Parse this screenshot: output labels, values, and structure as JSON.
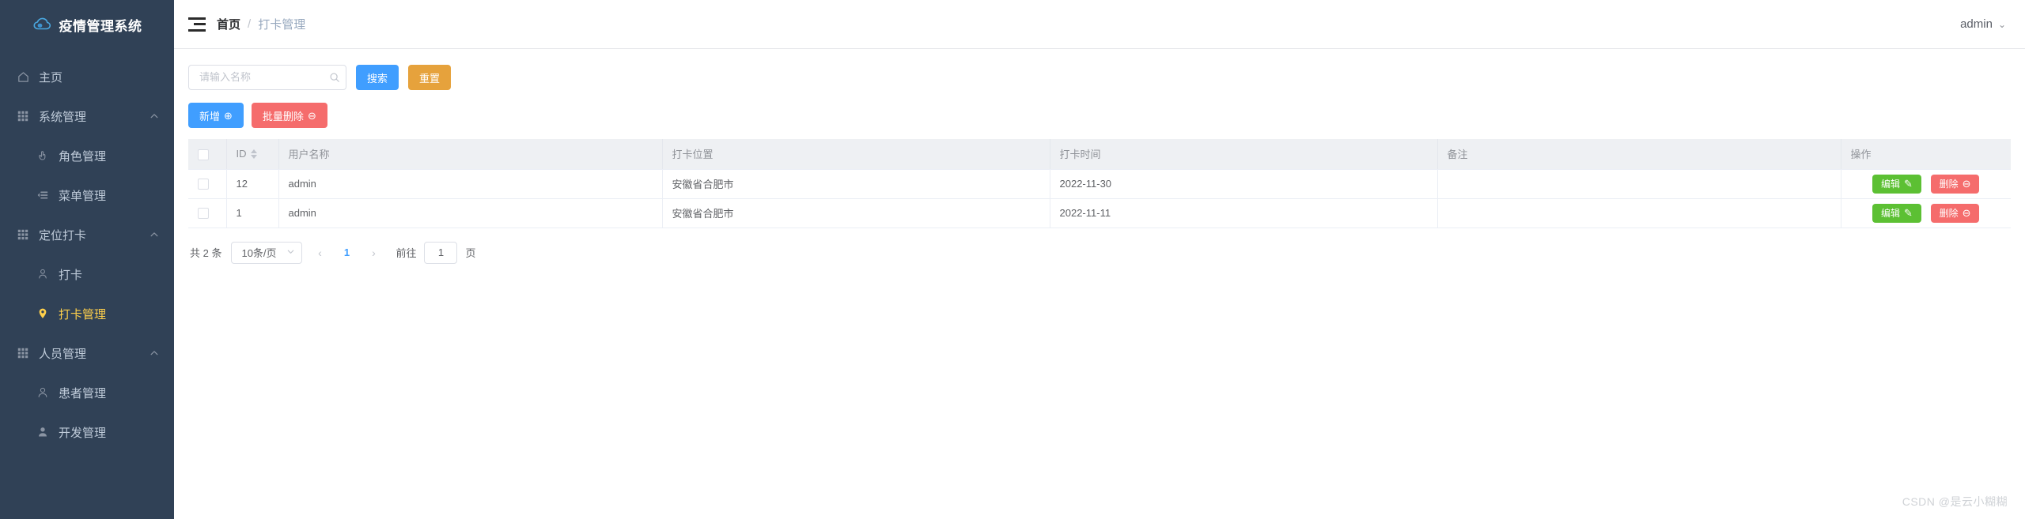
{
  "sidebar": {
    "logo_text": "疫情管理系统",
    "items": [
      {
        "label": "主页",
        "icon": "home-icon",
        "type": "leaf-top",
        "active": false
      },
      {
        "label": "系统管理",
        "icon": "grid-icon",
        "type": "group",
        "expanded": true
      },
      {
        "label": "角色管理",
        "icon": "hand-icon",
        "type": "leaf",
        "active": false
      },
      {
        "label": "菜单管理",
        "icon": "menu-list-icon",
        "type": "leaf",
        "active": false
      },
      {
        "label": "定位打卡",
        "icon": "grid-icon",
        "type": "group",
        "expanded": true
      },
      {
        "label": "打卡",
        "icon": "user-location-icon",
        "type": "leaf",
        "active": false
      },
      {
        "label": "打卡管理",
        "icon": "map-pin-icon",
        "type": "leaf",
        "active": true
      },
      {
        "label": "人员管理",
        "icon": "grid-icon",
        "type": "group",
        "expanded": true
      },
      {
        "label": "患者管理",
        "icon": "user-outline-icon",
        "type": "leaf",
        "active": false
      },
      {
        "label": "开发管理",
        "icon": "user-solid-icon",
        "type": "leaf",
        "active": false
      }
    ]
  },
  "navbar": {
    "collapse_icon": "hamburger-icon",
    "breadcrumb_home": "首页",
    "breadcrumb_separator": "/",
    "breadcrumb_current": "打卡管理",
    "user_name": "admin",
    "user_caret": "⌄"
  },
  "toolbar": {
    "search_placeholder": "请输入名称",
    "search_value": "",
    "search_icon": "magnifier-icon",
    "search_button": "搜索",
    "reset_button": "重置",
    "add_button": "新增",
    "add_icon": "⊕",
    "batch_delete_button": "批量删除",
    "batch_delete_icon": "⊖"
  },
  "table": {
    "columns": [
      "ID",
      "用户名称",
      "打卡位置",
      "打卡时间",
      "备注",
      "操作"
    ],
    "sortable_column": "ID",
    "rows": [
      {
        "checked": false,
        "id": "12",
        "user": "admin",
        "location": "安徽省合肥市",
        "time": "2022-11-30",
        "note": ""
      },
      {
        "checked": false,
        "id": "1",
        "user": "admin",
        "location": "安徽省合肥市",
        "time": "2022-11-11",
        "note": ""
      }
    ],
    "row_actions": {
      "edit_label": "编辑",
      "edit_icon": "✎",
      "delete_label": "删除",
      "delete_icon": "⊖"
    }
  },
  "pagination": {
    "total_text": "共 2 条",
    "page_size": "10条/页",
    "prev_icon": "‹",
    "next_icon": "›",
    "current_page": "1",
    "jump_label": "前往",
    "jump_value": "1",
    "jump_suffix": "页"
  },
  "watermark": "CSDN @是云小糊糊",
  "colors": {
    "sidebar_bg": "#304156",
    "sidebar_text": "#bfcbd9",
    "active_gold": "#ffd04b",
    "primary_blue": "#409eff",
    "warning_orange": "#e6a23c",
    "danger_red": "#f56c6c",
    "success_green": "#5cc033",
    "table_header_bg": "#eef0f3"
  }
}
